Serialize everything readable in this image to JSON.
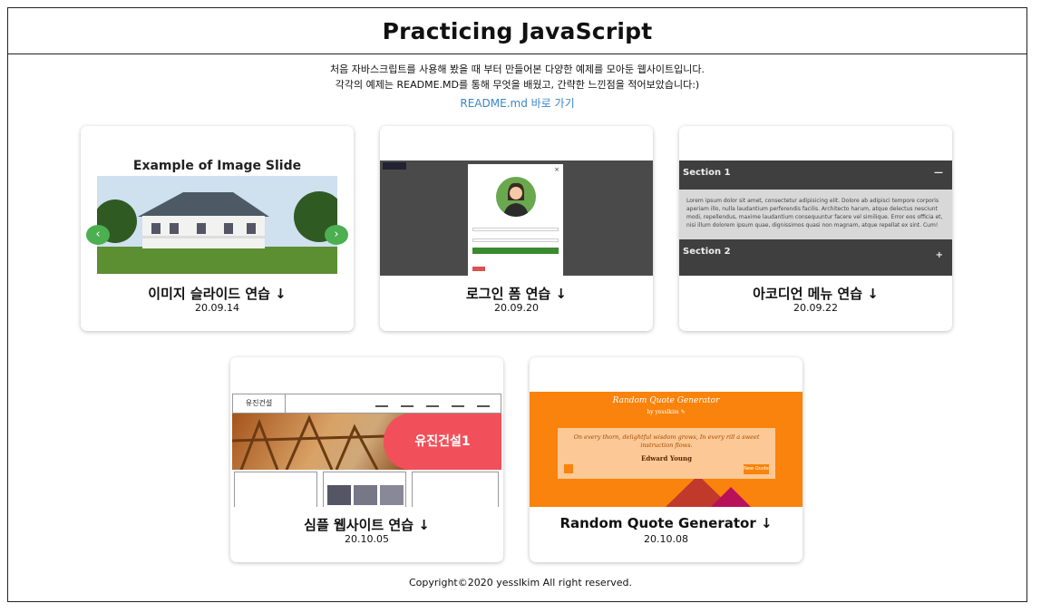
{
  "header": {
    "title": "Practicing JavaScript"
  },
  "intro": {
    "line1": "처음 자바스크립트를 사용해 봤을 때 부터 만들어본 다양한 예제를 모아둔 웹사이트입니다.",
    "line2": "각각의 예제는 README.MD를 통해 무엇을 배웠고, 간략한 느낀점을 적어보았습니다:)",
    "readme_link": "README.md 바로 가기"
  },
  "cards": [
    {
      "title": "이미지 슬라이드 연습 ↓",
      "date": "20.09.14",
      "thumb_heading": "Example of Image Slide",
      "arrow_left": "‹",
      "arrow_right": "›"
    },
    {
      "title": "로그인 폼 연습 ↓",
      "date": "20.09.20",
      "close_glyph": "×"
    },
    {
      "title": "아코디언 메뉴 연습 ↓",
      "date": "20.09.22",
      "section1": "Section 1",
      "section2": "Section 2",
      "section1_sign": "—",
      "section2_sign": "+",
      "body_text": "Lorem ipsum dolor sit amet, consectetur adipisicing elit. Dolore ab adipisci tempore corporis aperiam illo, nulla laudantium perferendis facilis. Architecto harum, atque delectus nesciunt modi, repellendus, maxime laudantium consequuntur facere vel similique. Error eos officia et, nisi illum dolorem ipsum quae, dignissimos quasi non magnam, atque repellat ex sint. Cum!"
    },
    {
      "title": "심플 웹사이트 연습 ↓",
      "date": "20.10.05",
      "logo": "유진건설",
      "banner_text": "유진건설1"
    },
    {
      "title": "Random Quote Generator ↓",
      "date": "20.10.08",
      "quote_title": "Random Quote Generator",
      "quote_by": "by yesslkim ✎",
      "quote_text": "On every thorn, delightful wisdom grows, In every rill a sweet instruction flows.",
      "quote_author": "Edward Young",
      "new_quote": "New Quote"
    }
  ],
  "footer": {
    "copyright": "Copyright©2020 yesslkim All right reserved."
  },
  "colors": {
    "link": "#3b86c8",
    "slide_arrow": "#4caf50",
    "quote_orange": "#f9830c",
    "site_red": "#f1505a"
  }
}
